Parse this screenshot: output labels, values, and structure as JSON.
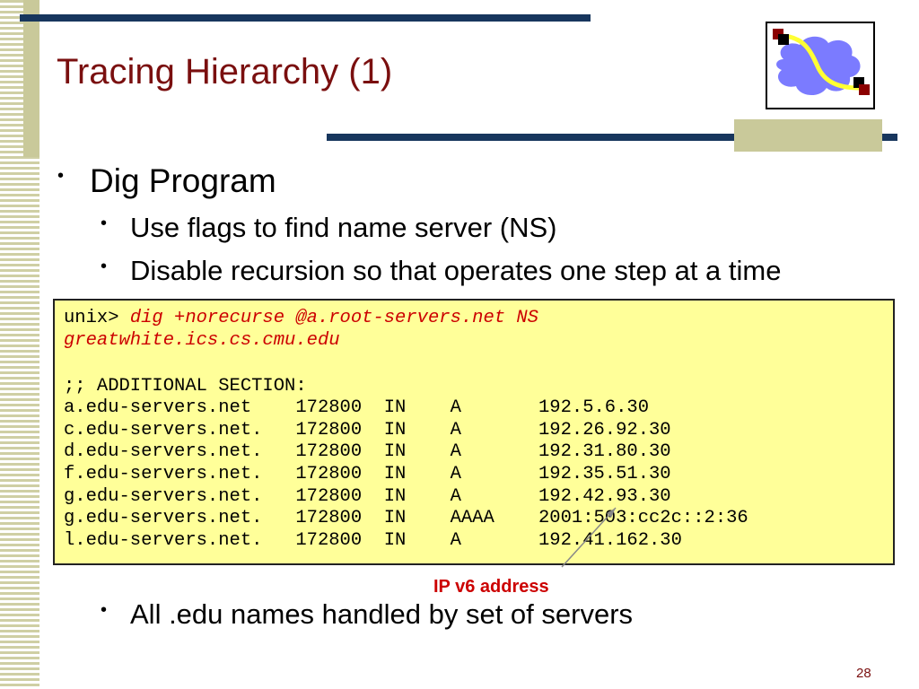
{
  "slide": {
    "title": "Tracing Hierarchy (1)",
    "page_number": "28",
    "bullet": "Dig Program",
    "subbullets": [
      "Use flags to find name server (NS)",
      "Disable recursion so that operates one step at a time"
    ],
    "last_subbullet": "All .edu names handled by set of servers",
    "annotation": "IP v6 address",
    "bullet_glyph": "•"
  },
  "code": {
    "prompt": "unix> ",
    "command_line1": "dig +norecurse @a.root-servers.net NS",
    "command_line2": "greatwhite.ics.cs.cmu.edu",
    "section_header": ";; ADDITIONAL SECTION:",
    "records": [
      "a.edu-servers.net    172800  IN    A       192.5.6.30",
      "c.edu-servers.net.   172800  IN    A       192.26.92.30",
      "d.edu-servers.net.   172800  IN    A       192.31.80.30",
      "f.edu-servers.net.   172800  IN    A       192.35.51.30",
      "g.edu-servers.net.   172800  IN    A       192.42.93.30",
      "g.edu-servers.net.   172800  IN    AAAA    2001:503:cc2c::2:36",
      "l.edu-servers.net.   172800  IN    A       192.41.162.30"
    ]
  },
  "colors": {
    "title": "#7a0f0f",
    "accent_bar": "#17365d",
    "code_bg": "#ffff99",
    "command": "#cc0000"
  },
  "icons": {
    "logo": "network-cloud-logo-icon"
  }
}
